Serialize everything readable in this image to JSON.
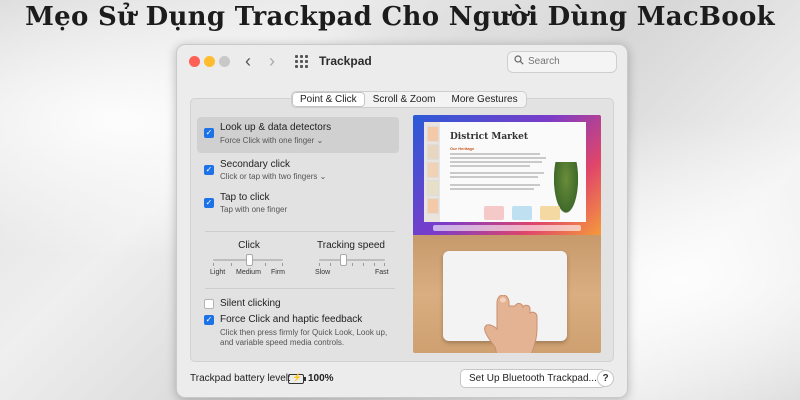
{
  "headline": "Mẹo Sử Dụng Trackpad Cho Người Dùng MacBook",
  "window": {
    "title": "Trackpad",
    "search_placeholder": "Search"
  },
  "tabs": [
    "Point & Click",
    "Scroll & Zoom",
    "More Gestures"
  ],
  "selected_tab": "Point & Click",
  "options": [
    {
      "title": "Look up & data detectors",
      "subtitle": "Force Click with one finger ⌄",
      "checked": true
    },
    {
      "title": "Secondary click",
      "subtitle": "Click or tap with two fingers ⌄",
      "checked": true
    },
    {
      "title": "Tap to click",
      "subtitle": "Tap with one finger",
      "checked": true
    }
  ],
  "sliders": {
    "click": {
      "title": "Click",
      "labels": [
        "Light",
        "Medium",
        "Firm"
      ],
      "value": "Medium"
    },
    "tracking": {
      "title": "Tracking speed",
      "min_label": "Slow",
      "max_label": "Fast"
    }
  },
  "bottom_options": [
    {
      "title": "Silent clicking",
      "checked": false
    },
    {
      "title": "Force Click and haptic feedback",
      "checked": true,
      "description": "Click then press firmly for Quick Look, Look up, and variable speed media controls."
    }
  ],
  "preview": {
    "doc_title": "District Market",
    "doc_subtitle": "Our Heritage"
  },
  "footer": {
    "battery_label": "Trackpad battery level:",
    "battery_value": "100%",
    "setup_button": "Set Up Bluetooth Trackpad...",
    "help_button": "?"
  }
}
